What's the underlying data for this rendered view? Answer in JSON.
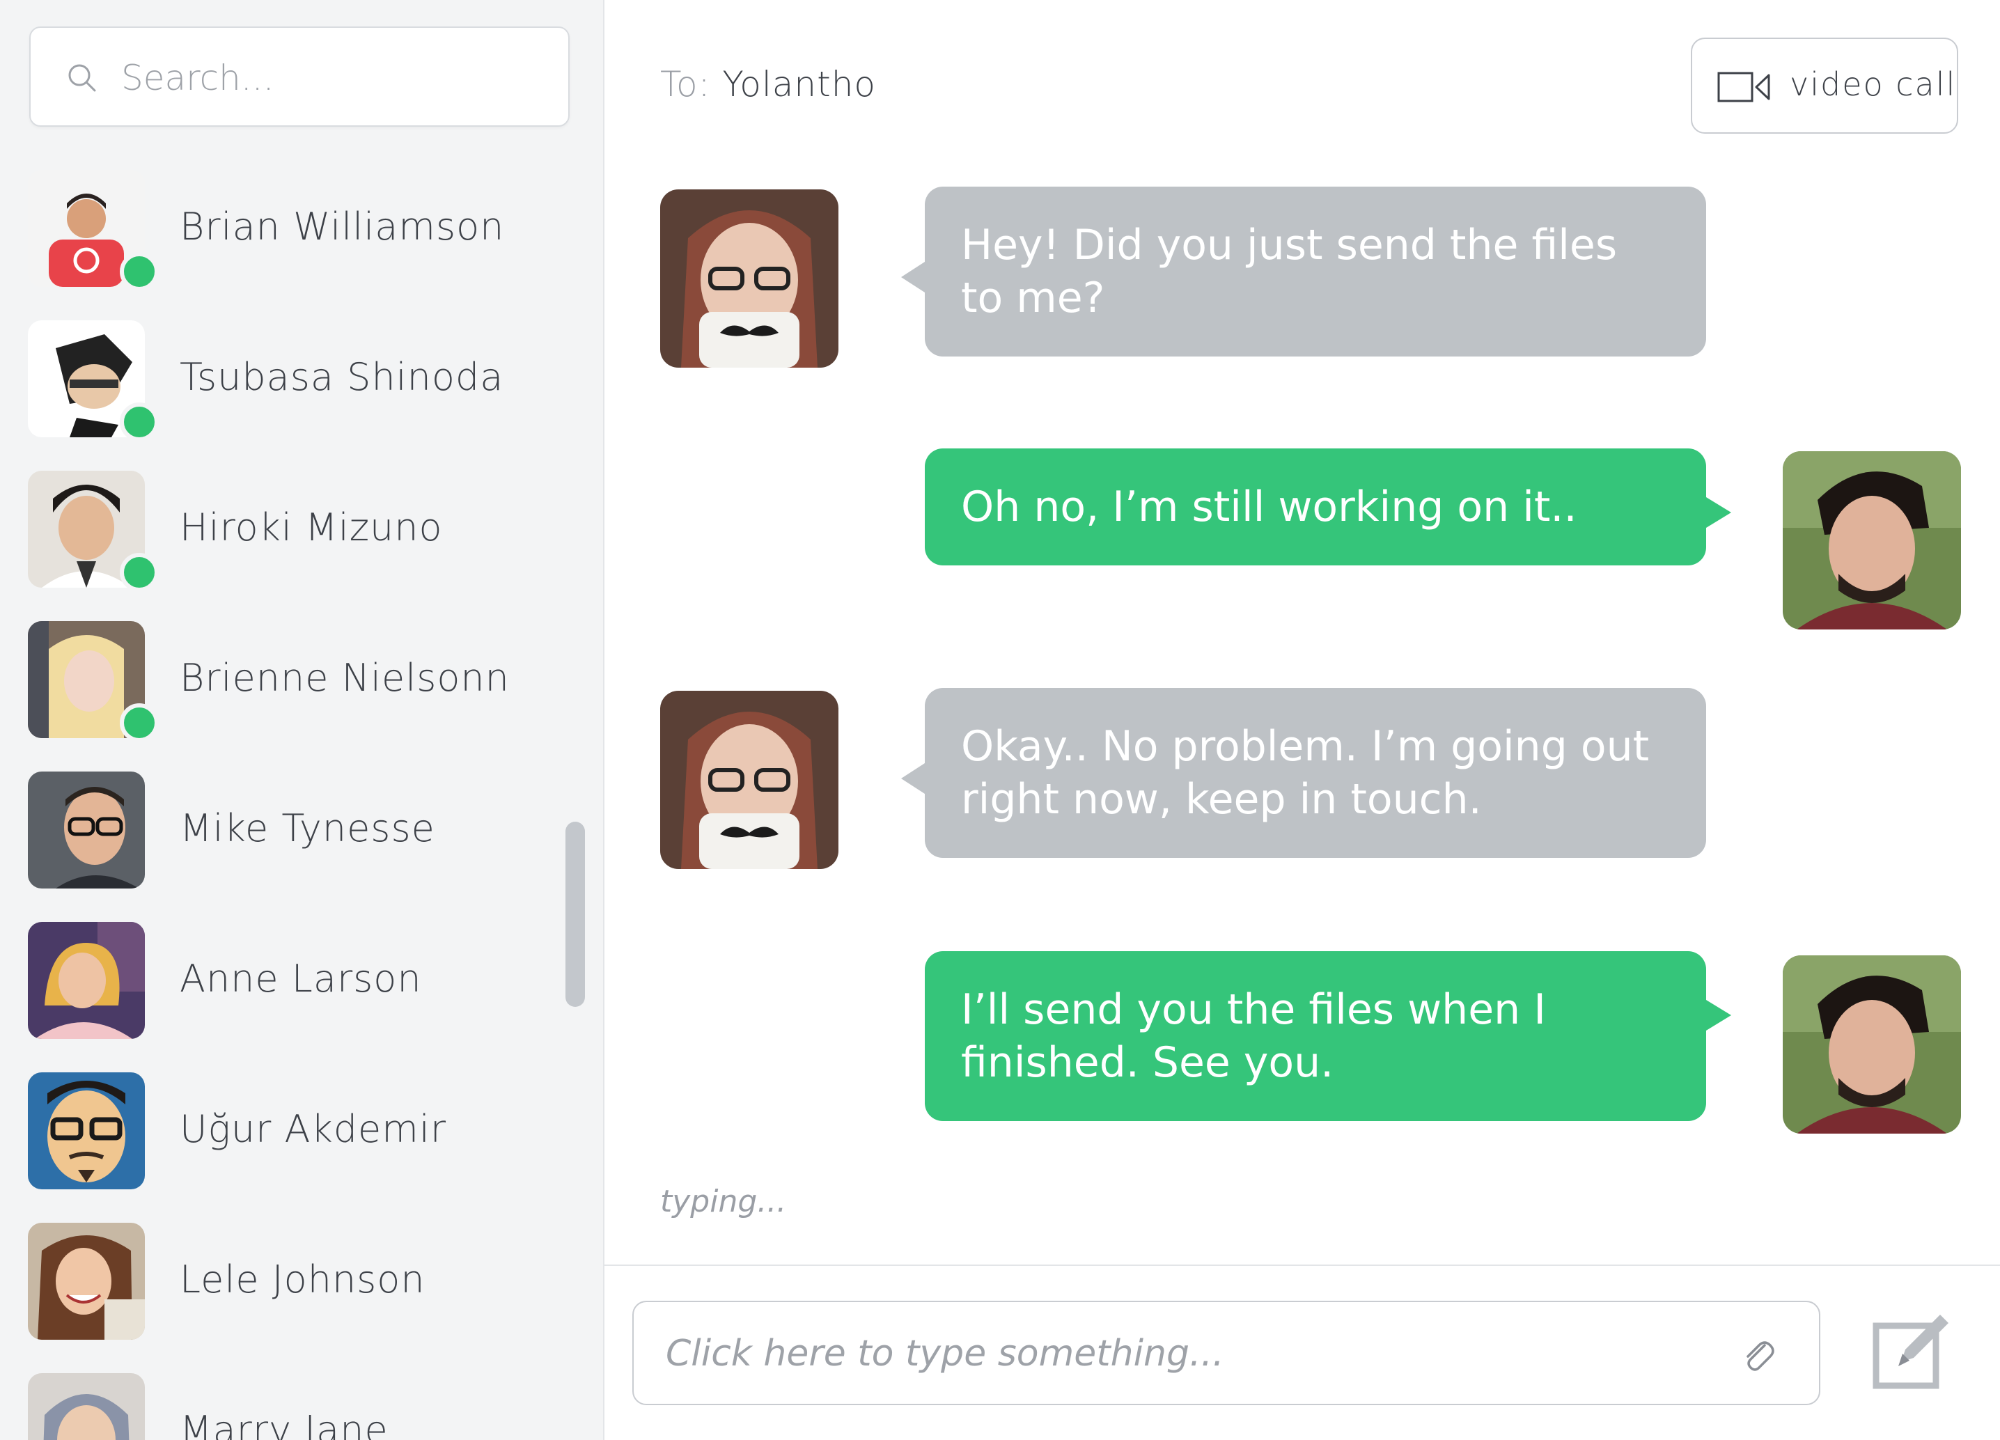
{
  "sidebar": {
    "search": {
      "placeholder": "Search..."
    },
    "contacts": [
      {
        "name": "Brian Williamson",
        "online": true,
        "avatar": "avatar-brian"
      },
      {
        "name": "Tsubasa Shinoda",
        "online": true,
        "avatar": "avatar-tsubasa"
      },
      {
        "name": "Hiroki Mizuno",
        "online": true,
        "avatar": "avatar-hiroki"
      },
      {
        "name": "Brienne Nielsonn",
        "online": true,
        "avatar": "avatar-brienne"
      },
      {
        "name": "Mike Tynesse",
        "online": false,
        "avatar": "avatar-mike"
      },
      {
        "name": "Anne Larson",
        "online": false,
        "avatar": "avatar-anne"
      },
      {
        "name": "Uğur Akdemir",
        "online": false,
        "avatar": "avatar-ugur"
      },
      {
        "name": "Lele Johnson",
        "online": false,
        "avatar": "avatar-lele"
      },
      {
        "name": "Marry Jane",
        "online": false,
        "avatar": "avatar-marry"
      }
    ]
  },
  "chat": {
    "header": {
      "to_label": "To:",
      "recipient": "Yolantho",
      "video_call_label": "video call"
    },
    "messages": [
      {
        "direction": "in",
        "text": "Hey! Did you just send the files to me?"
      },
      {
        "direction": "out",
        "text": "Oh no, I’m still working on it.."
      },
      {
        "direction": "in",
        "text": "Okay.. No problem. I’m going out right now, keep in touch."
      },
      {
        "direction": "out",
        "text": "I’ll send you the files when I finished. See you."
      }
    ],
    "typing_indicator": "typing...",
    "composer": {
      "placeholder": "Click here to type something..."
    }
  },
  "colors": {
    "online": "#2fc26f",
    "bubble_in": "#bec2c6",
    "bubble_out": "#35c57a",
    "sidebar_bg": "#f3f4f5"
  },
  "icons": [
    "search-icon",
    "video-camera-icon",
    "paperclip-icon",
    "compose-icon"
  ]
}
